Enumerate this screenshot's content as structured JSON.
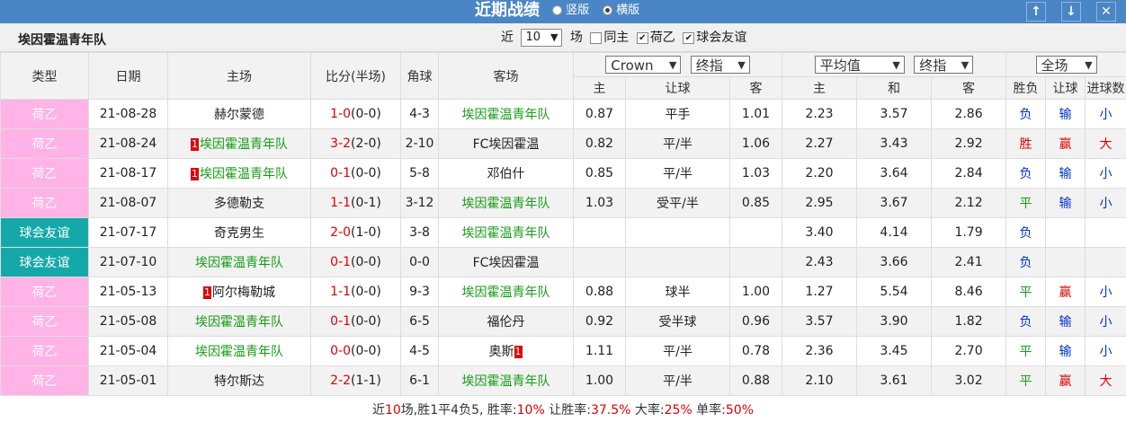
{
  "header": {
    "title": "近期战绩",
    "opt_vertical": "竖版",
    "opt_horizontal": "横版",
    "btn_up": "↑",
    "btn_down": "↓",
    "btn_close": "✕"
  },
  "subbar": {
    "team": "埃因霍温青年队",
    "prefix": "近",
    "count": "10",
    "suffix": "场",
    "cb_same_home": "同主",
    "cb_eredivisie": "荷乙",
    "cb_friendly": "球会友谊",
    "cb_same_home_checked": false,
    "cb_eredivisie_checked": true,
    "cb_friendly_checked": true
  },
  "columns": {
    "type": "类型",
    "date": "日期",
    "home": "主场",
    "score": "比分(半场)",
    "corner": "角球",
    "away": "客场",
    "company": "Crown",
    "odds_kind": "终指",
    "avg_kind": "平均值",
    "avg_odds_kind": "终指",
    "scope": "全场",
    "sub_home": "主",
    "sub_handicap": "让球",
    "sub_away": "客",
    "sub_avg_home": "主",
    "sub_avg_draw": "和",
    "sub_avg_away": "客",
    "sub_result": "胜负",
    "sub_hc_result": "让球",
    "sub_goals": "进球数",
    "arrow": "▼"
  },
  "rows": [
    {
      "league": "荷乙",
      "league_kind": "nl",
      "date": "21-08-28",
      "home": "赫尔蒙德",
      "home_rank": "",
      "home_green": false,
      "score": "1-0",
      "half": "(0-0)",
      "corner": "4-3",
      "away": "埃因霍温青年队",
      "away_rank": "",
      "away_green": true,
      "o_home": "0.87",
      "o_hc": "平手",
      "o_away": "1.01",
      "a_home": "2.23",
      "a_draw": "3.57",
      "a_away": "2.86",
      "result": "负",
      "result_color": "blue",
      "hc_result": "输",
      "hc_color": "blue",
      "goals": "小",
      "goals_color": "blue"
    },
    {
      "league": "荷乙",
      "league_kind": "nl",
      "date": "21-08-24",
      "home": "埃因霍温青年队",
      "home_rank": "1",
      "home_green": true,
      "score": "3-2",
      "half": "(2-0)",
      "corner": "2-10",
      "away": "FC埃因霍温",
      "away_rank": "",
      "away_green": false,
      "o_home": "0.82",
      "o_hc": "平/半",
      "o_away": "1.06",
      "a_home": "2.27",
      "a_draw": "3.43",
      "a_away": "2.92",
      "result": "胜",
      "result_color": "red",
      "hc_result": "赢",
      "hc_color": "red",
      "goals": "大",
      "goals_color": "red"
    },
    {
      "league": "荷乙",
      "league_kind": "nl",
      "date": "21-08-17",
      "home": "埃因霍温青年队",
      "home_rank": "1",
      "home_green": true,
      "score": "0-1",
      "half": "(0-0)",
      "corner": "5-8",
      "away": "邓伯什",
      "away_rank": "",
      "away_green": false,
      "o_home": "0.85",
      "o_hc": "平/半",
      "o_away": "1.03",
      "a_home": "2.20",
      "a_draw": "3.64",
      "a_away": "2.84",
      "result": "负",
      "result_color": "blue",
      "hc_result": "输",
      "hc_color": "blue",
      "goals": "小",
      "goals_color": "blue"
    },
    {
      "league": "荷乙",
      "league_kind": "nl",
      "date": "21-08-07",
      "home": "多德勒支",
      "home_rank": "",
      "home_green": false,
      "score": "1-1",
      "half": "(0-1)",
      "corner": "3-12",
      "away": "埃因霍温青年队",
      "away_rank": "",
      "away_green": true,
      "o_home": "1.03",
      "o_hc": "受平/半",
      "o_away": "0.85",
      "a_home": "2.95",
      "a_draw": "3.67",
      "a_away": "2.12",
      "result": "平",
      "result_color": "green",
      "hc_result": "输",
      "hc_color": "blue",
      "goals": "小",
      "goals_color": "blue"
    },
    {
      "league": "球会友谊",
      "league_kind": "fr",
      "date": "21-07-17",
      "home": "奇克男生",
      "home_rank": "",
      "home_green": false,
      "score": "2-0",
      "half": "(1-0)",
      "corner": "3-8",
      "away": "埃因霍温青年队",
      "away_rank": "",
      "away_green": true,
      "o_home": "",
      "o_hc": "",
      "o_away": "",
      "a_home": "3.40",
      "a_draw": "4.14",
      "a_away": "1.79",
      "result": "负",
      "result_color": "blue",
      "hc_result": "",
      "hc_color": "blue",
      "goals": "",
      "goals_color": "blue"
    },
    {
      "league": "球会友谊",
      "league_kind": "fr",
      "date": "21-07-10",
      "home": "埃因霍温青年队",
      "home_rank": "",
      "home_green": true,
      "score": "0-1",
      "half": "(0-0)",
      "corner": "0-0",
      "away": "FC埃因霍温",
      "away_rank": "",
      "away_green": false,
      "o_home": "",
      "o_hc": "",
      "o_away": "",
      "a_home": "2.43",
      "a_draw": "3.66",
      "a_away": "2.41",
      "result": "负",
      "result_color": "blue",
      "hc_result": "",
      "hc_color": "blue",
      "goals": "",
      "goals_color": "blue"
    },
    {
      "league": "荷乙",
      "league_kind": "nl",
      "date": "21-05-13",
      "home": "阿尔梅勒城",
      "home_rank": "1",
      "home_green": false,
      "score": "1-1",
      "half": "(0-0)",
      "corner": "9-3",
      "away": "埃因霍温青年队",
      "away_rank": "",
      "away_green": true,
      "o_home": "0.88",
      "o_hc": "球半",
      "o_away": "1.00",
      "a_home": "1.27",
      "a_draw": "5.54",
      "a_away": "8.46",
      "result": "平",
      "result_color": "green",
      "hc_result": "赢",
      "hc_color": "red",
      "goals": "小",
      "goals_color": "blue"
    },
    {
      "league": "荷乙",
      "league_kind": "nl",
      "date": "21-05-08",
      "home": "埃因霍温青年队",
      "home_rank": "",
      "home_green": true,
      "score": "0-1",
      "half": "(0-0)",
      "corner": "6-5",
      "away": "福伦丹",
      "away_rank": "",
      "away_green": false,
      "o_home": "0.92",
      "o_hc": "受半球",
      "o_away": "0.96",
      "a_home": "3.57",
      "a_draw": "3.90",
      "a_away": "1.82",
      "result": "负",
      "result_color": "blue",
      "hc_result": "输",
      "hc_color": "blue",
      "goals": "小",
      "goals_color": "blue"
    },
    {
      "league": "荷乙",
      "league_kind": "nl",
      "date": "21-05-04",
      "home": "埃因霍温青年队",
      "home_rank": "",
      "home_green": true,
      "score": "0-0",
      "half": "(0-0)",
      "corner": "4-5",
      "away": "奥斯",
      "away_rank": "1",
      "away_green": false,
      "o_home": "1.11",
      "o_hc": "平/半",
      "o_away": "0.78",
      "a_home": "2.36",
      "a_draw": "3.45",
      "a_away": "2.70",
      "result": "平",
      "result_color": "green",
      "hc_result": "输",
      "hc_color": "blue",
      "goals": "小",
      "goals_color": "blue"
    },
    {
      "league": "荷乙",
      "league_kind": "nl",
      "date": "21-05-01",
      "home": "特尔斯达",
      "home_rank": "",
      "home_green": false,
      "score": "2-2",
      "half": "(1-1)",
      "corner": "6-1",
      "away": "埃因霍温青年队",
      "away_rank": "",
      "away_green": true,
      "o_home": "1.00",
      "o_hc": "平/半",
      "o_away": "0.88",
      "a_home": "2.10",
      "a_draw": "3.61",
      "a_away": "3.02",
      "result": "平",
      "result_color": "green",
      "hc_result": "赢",
      "hc_color": "red",
      "goals": "大",
      "goals_color": "red"
    }
  ],
  "summary": {
    "t1": "近",
    "n_games": "10",
    "t2": "场,胜",
    "n_win": "1",
    "t3": "平",
    "n_draw": "4",
    "t4": "负",
    "n_loss": "5",
    "t5": ", 胜率:",
    "win_rate": "10%",
    "t6": " 让胜率:",
    "hc_rate": "37.5%",
    "t7": " 大率:",
    "big_rate": "25%",
    "t8": " 单率:",
    "odd_rate": "50%"
  }
}
